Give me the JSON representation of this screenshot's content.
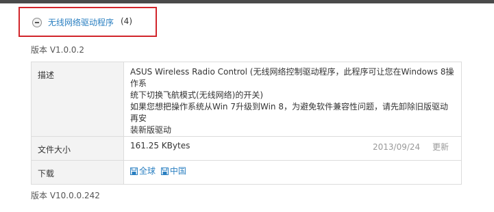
{
  "section": {
    "title": "无线网络驱动程序",
    "count": "(4)"
  },
  "versions": [
    {
      "label": "版本 V1.0.0.2",
      "rows": {
        "description": {
          "label": "描述",
          "lines": [
            "ASUS Wireless Radio Control (无线网络控制驱动程序，此程序可让您在Windows 8操作系",
            "统下切换飞航模式(无线网络)的开关)",
            "如果您想把操作系统从Win 7升级到Win 8，为避免软件兼容性问题，请先卸除旧版驱动再安",
            "装新版驱动"
          ]
        },
        "file_size": {
          "label": "文件大小",
          "value": "161.25 KBytes",
          "date": "2013/09/24",
          "update": "更新"
        },
        "download": {
          "label": "下载",
          "links": [
            "全球",
            "中国"
          ]
        }
      }
    },
    {
      "label": "版本 V10.0.0.242"
    }
  ],
  "colors": {
    "accent_link": "#2a7fc1",
    "highlight_border": "#d1242a",
    "label_bg": "#f3f3f3",
    "border": "#dcdcdc"
  },
  "icons": [
    "minus-circle-icon",
    "save-icon"
  ]
}
